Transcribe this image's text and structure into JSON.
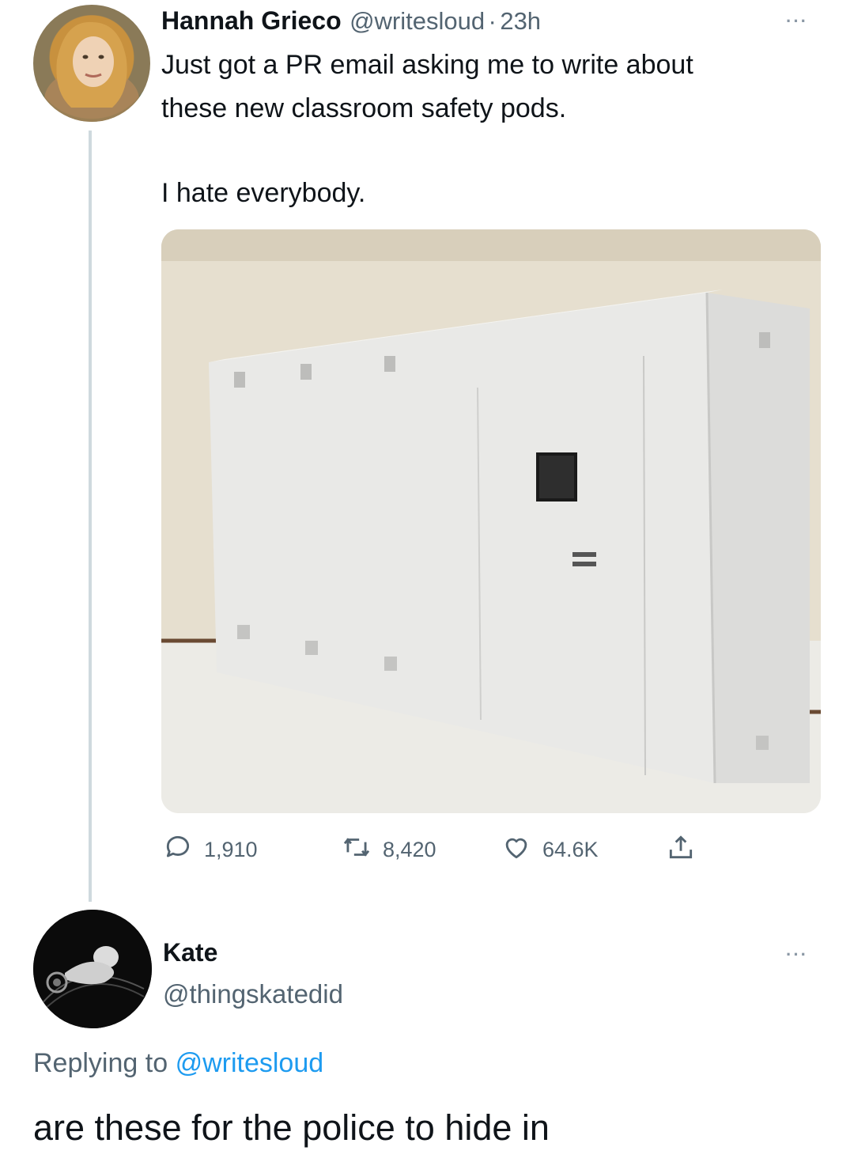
{
  "tweet": {
    "author_name": "Hannah Grieco",
    "author_handle": "@writesloud",
    "separator": "·",
    "timestamp": "23h",
    "text_line1": "Just got a PR email asking me to write about",
    "text_line2": "these new classroom safety pods.",
    "text_line3": "I hate everybody.",
    "more_label": "···",
    "stats": {
      "replies": "1,910",
      "retweets": "8,420",
      "likes": "64.6K"
    }
  },
  "reply": {
    "author_name": "Kate",
    "author_handle": "@thingskatedid",
    "more_label": "···",
    "replying_prefix": "Replying to",
    "replying_handle": "@writesloud",
    "text": "are these for the police to hide in"
  },
  "colors": {
    "text_primary": "#0f1419",
    "text_secondary": "#536471",
    "link": "#1d9bf0",
    "thread_line": "#cfd9de"
  },
  "icons": {
    "reply": "reply-bubble-icon",
    "retweet": "retweet-arrows-icon",
    "like": "heart-icon",
    "share": "share-upload-icon",
    "more": "ellipsis-icon"
  }
}
